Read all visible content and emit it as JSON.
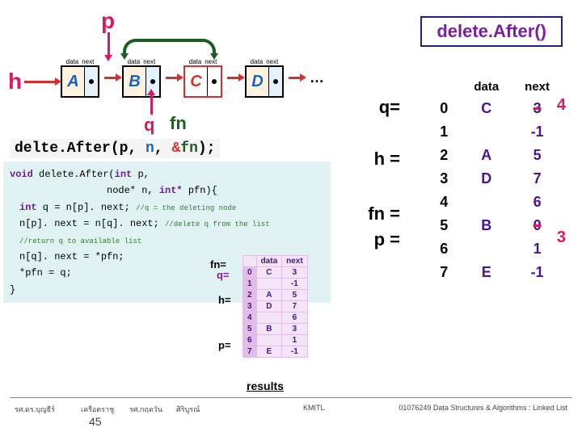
{
  "title": "delete.After()",
  "labels": {
    "p": "p",
    "h": "h",
    "q": "q",
    "fn": "fn",
    "ellipsis": "…"
  },
  "nodes": [
    "A",
    "B",
    "C",
    "D"
  ],
  "node_hdr": {
    "data": "data",
    "next": "next"
  },
  "call": {
    "fn": "delte.After(p, ",
    "n": "n",
    "comma": ", ",
    "amp": "&",
    "fnarg": "fn",
    "end": ");"
  },
  "code": {
    "l1a": "void",
    "l1b": " delete.After(",
    "l1c": "int",
    "l1d": " p,",
    "l2a": "node* n, ",
    "l2b": "int*",
    "l2c": " pfn){",
    "l3a": "int",
    "l3b": " q = n[p]. next;  ",
    "l3c": "//q = the deleting node",
    "l4a": "n[p]. next = n[q]. next; ",
    "l4c": "//delete q from the list",
    "l5a": "//return q to available list",
    "l6a": "n[q]. next = *pfn;",
    "l7a": "*pfn = q;",
    "l8a": "}"
  },
  "mini_labels": {
    "fn": "fn=",
    "q": "q=",
    "h": "h=",
    "p": "p="
  },
  "mini_hdr": {
    "data": "data",
    "next": "next"
  },
  "mini": [
    [
      "0",
      "C",
      "3"
    ],
    [
      "1",
      "",
      "-1"
    ],
    [
      "2",
      "A",
      "5"
    ],
    [
      "3",
      "D",
      "7"
    ],
    [
      "4",
      "",
      "6"
    ],
    [
      "5",
      "B",
      "3"
    ],
    [
      "6",
      "",
      "1"
    ],
    [
      "7",
      "E",
      "-1"
    ]
  ],
  "results_label": "results",
  "big_hdr": {
    "data": "data",
    "next": "next"
  },
  "big_labels": {
    "q": "q=",
    "h": "h =",
    "fn": "fn =",
    "p": "p ="
  },
  "big": [
    {
      "i": "0",
      "d": "C",
      "n": "3",
      "nn": "4"
    },
    {
      "i": "1",
      "d": "",
      "n": "-1",
      "nn": ""
    },
    {
      "i": "2",
      "d": "A",
      "n": "5",
      "nn": ""
    },
    {
      "i": "3",
      "d": "D",
      "n": "7",
      "nn": ""
    },
    {
      "i": "4",
      "d": "",
      "n": "6",
      "nn": ""
    },
    {
      "i": "5",
      "d": "B",
      "n": "0",
      "nn": "3"
    },
    {
      "i": "6",
      "d": "",
      "n": "1",
      "nn": ""
    },
    {
      "i": "7",
      "d": "E",
      "n": "-1",
      "nn": ""
    }
  ],
  "footer": {
    "a1": "รศ.ดร.บุญธีร์",
    "a2": "เครือตราชู",
    "a3": "รศ.กฤตวัน",
    "a4": "ศิริบูรณ์",
    "mid": "KMITL",
    "right": "01076249 Data Structures & Algorithms  : Linked List",
    "page": "45"
  }
}
